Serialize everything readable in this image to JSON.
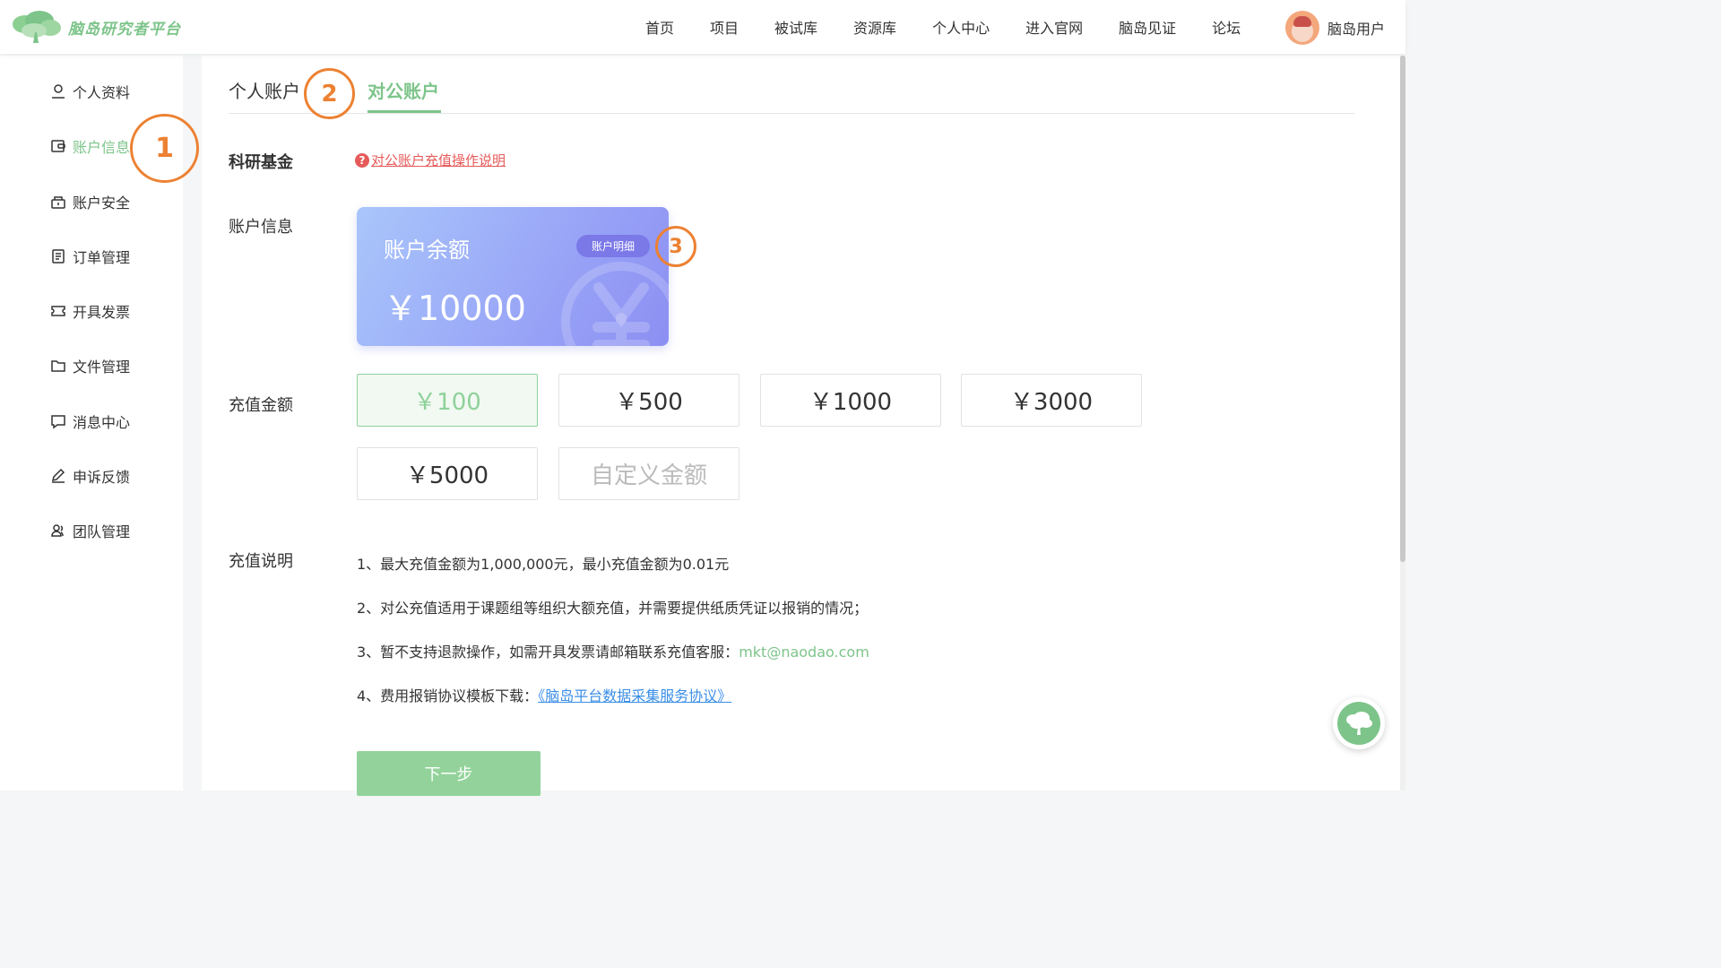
{
  "brand": {
    "name": "脑岛研究者平台"
  },
  "nav": [
    {
      "label": "首页"
    },
    {
      "label": "项目"
    },
    {
      "label": "被试库"
    },
    {
      "label": "资源库"
    },
    {
      "label": "个人中心"
    },
    {
      "label": "进入官网"
    },
    {
      "label": "脑岛见证"
    },
    {
      "label": "论坛"
    }
  ],
  "user": {
    "name": "脑岛用户"
  },
  "sidebar": {
    "active_index": 1,
    "items": [
      {
        "label": "个人资料",
        "icon": "user-icon"
      },
      {
        "label": "账户信息",
        "icon": "wallet-icon"
      },
      {
        "label": "账户安全",
        "icon": "lock-icon"
      },
      {
        "label": "订单管理",
        "icon": "order-icon"
      },
      {
        "label": "开具发票",
        "icon": "ticket-icon"
      },
      {
        "label": "文件管理",
        "icon": "folder-icon"
      },
      {
        "label": "消息中心",
        "icon": "message-icon"
      },
      {
        "label": "申诉反馈",
        "icon": "edit-icon"
      },
      {
        "label": "团队管理",
        "icon": "team-icon"
      }
    ]
  },
  "tabs": [
    {
      "label": "个人账户",
      "active": false
    },
    {
      "label": "对公账户",
      "active": true
    }
  ],
  "fund": {
    "label": "科研基金",
    "help_link": "对公账户充值操作说明"
  },
  "account": {
    "label": "账户信息",
    "card_title": "账户余额",
    "balance": "￥10000",
    "detail_button": "账户明细"
  },
  "recharge": {
    "label": "充值金额",
    "selected_index": 0,
    "options": [
      "￥100",
      "￥500",
      "￥1000",
      "￥3000",
      "￥5000"
    ],
    "custom_placeholder": "自定义金额"
  },
  "notes": {
    "label": "充值说明",
    "line1": "1、最大充值金额为1,000,000元，最小充值金额为0.01元",
    "line2": "2、对公充值适用于课题组等组织大额充值，并需要提供纸质凭证以报销的情况；",
    "line3_prefix": "3、暂不支持退款操作，如需开具发票请邮箱联系充值客服：",
    "email": "mkt@naodao.com",
    "line4_prefix": "4、费用报销协议模板下载：",
    "agreement": "《脑岛平台数据采集服务协议》"
  },
  "next_button": "下一步",
  "annotations": [
    "1",
    "2",
    "3"
  ],
  "colors": {
    "accent": "#7dc48a",
    "annotation": "#ec8132",
    "link_red": "#e65a5a",
    "link_blue": "#3a8ee6",
    "card_gradient_start": "#a9c6fb",
    "card_gradient_end": "#8c8ff2"
  }
}
